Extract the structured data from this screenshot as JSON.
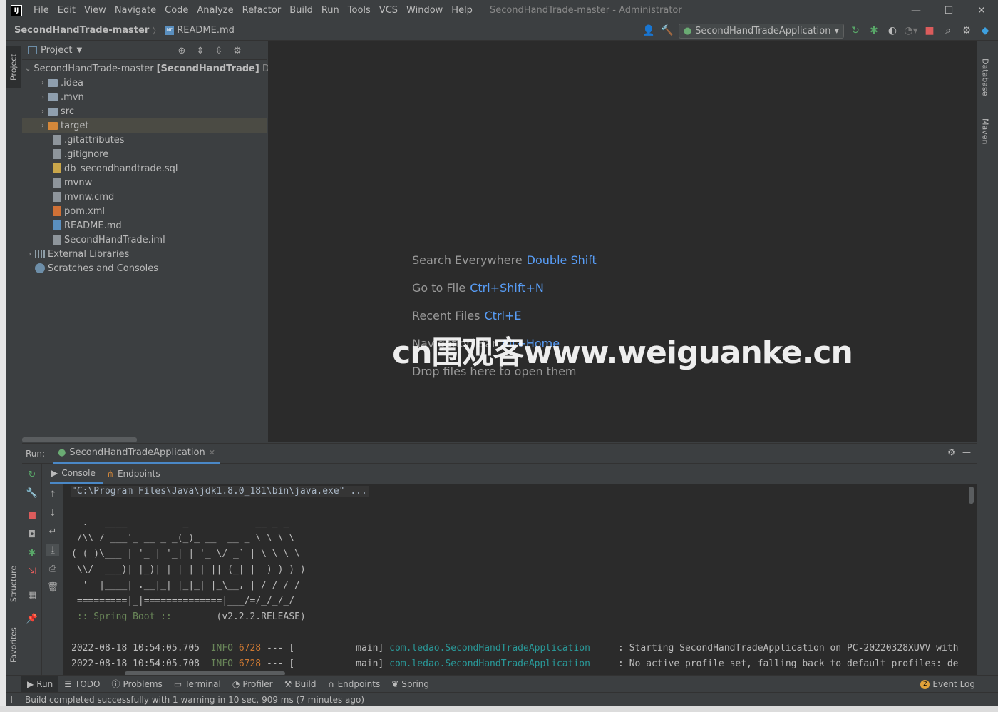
{
  "app": {
    "logo": "IJ",
    "window_title": "SecondHandTrade-master - Administrator",
    "menu": [
      "File",
      "Edit",
      "View",
      "Navigate",
      "Code",
      "Analyze",
      "Refactor",
      "Build",
      "Run",
      "Tools",
      "VCS",
      "Window",
      "Help"
    ],
    "window_controls": {
      "minimize": "—",
      "maximize": "☐",
      "close": "✕"
    }
  },
  "navbar": {
    "project": "SecondHandTrade-master",
    "file": "README.md",
    "run_config": "SecondHandTradeApplication"
  },
  "left_stripe": {
    "project_tab": "Project",
    "structure_tab": "Structure",
    "favorites_tab": "Favorites"
  },
  "right_stripe": {
    "database_tab": "Database",
    "maven_tab": "Maven"
  },
  "project_panel": {
    "title": "Project",
    "root": {
      "name": "SecondHandTrade-master",
      "module": "[SecondHandTrade]",
      "path": "D:\\"
    },
    "folders": [
      ".idea",
      ".mvn",
      "src",
      "target"
    ],
    "files": [
      ".gitattributes",
      ".gitignore",
      "db_secondhandtrade.sql",
      "mvnw",
      "mvnw.cmd",
      "pom.xml",
      "README.md",
      "SecondHandTrade.iml"
    ],
    "external_libraries": "External Libraries",
    "scratches": "Scratches and Consoles"
  },
  "editor": {
    "hints": [
      {
        "label": "Search Everywhere",
        "key": "Double Shift"
      },
      {
        "label": "Go to File",
        "key": "Ctrl+Shift+N"
      },
      {
        "label": "Recent Files",
        "key": "Ctrl+E"
      },
      {
        "label": "Navigation Bar",
        "key": "Alt+Home"
      },
      {
        "label": "Drop files here to open them",
        "key": ""
      }
    ],
    "watermark": "cn围观客www.weiguanke.cn"
  },
  "run_panel": {
    "label": "Run:",
    "tab": "SecondHandTradeApplication",
    "console_tab": "Console",
    "endpoints_tab": "Endpoints",
    "command": "\"C:\\Program Files\\Java\\jdk1.8.0_181\\bin\\java.exe\" ...",
    "banner": [
      "  .   ____          _            __ _ _",
      " /\\\\ / ___'_ __ _ _(_)_ __  __ _ \\ \\ \\ \\",
      "( ( )\\___ | '_ | '_| | '_ \\/ _` | \\ \\ \\ \\",
      " \\\\/  ___)| |_)| | | | | || (_| |  ) ) ) )",
      "  '  |____| .__|_| |_|_| |_\\__, | / / / /",
      " =========|_|==============|___/=/_/_/_/"
    ],
    "boot_label": " :: Spring Boot :: ",
    "boot_version": "       (v2.2.2.RELEASE)",
    "log_lines": [
      {
        "time": "2022-08-18 10:54:05.705",
        "level": "INFO",
        "pid": "6728",
        "sep": "--- [",
        "thread": "           main]",
        "logger": "com.ledao.SecondHandTradeApplication",
        "msg": "     : Starting SecondHandTradeApplication on PC-20220328XUVV with"
      },
      {
        "time": "2022-08-18 10:54:05.708",
        "level": "INFO",
        "pid": "6728",
        "sep": "--- [",
        "thread": "           main]",
        "logger": "com.ledao.SecondHandTradeApplication",
        "msg": "     : No active profile set, falling back to default profiles: de"
      }
    ]
  },
  "toolwindows": {
    "items": [
      "Run",
      "TODO",
      "Problems",
      "Terminal",
      "Profiler",
      "Build",
      "Endpoints",
      "Spring"
    ],
    "event_log": "Event Log",
    "event_count": "2"
  },
  "status": {
    "message": "Build completed successfully with 1 warning in 10 sec, 909 ms (7 minutes ago)"
  }
}
